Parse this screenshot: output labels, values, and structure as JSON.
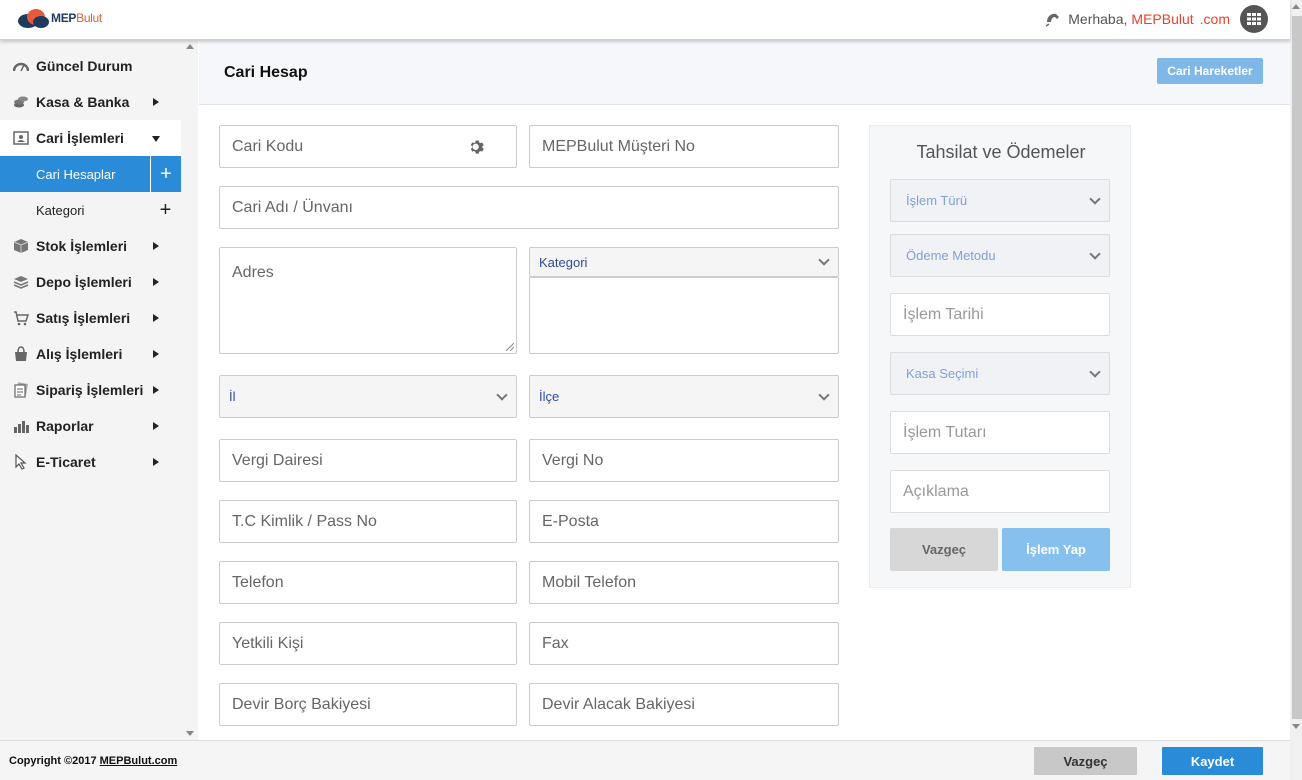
{
  "header": {
    "logo_main": "MEP",
    "logo_accent": "Bulut",
    "greeting": "Merhaba,",
    "brand": "MEPBulut",
    "domain": ".com"
  },
  "sidebar": {
    "items": [
      {
        "label": "Güncel Durum",
        "icon": "speedometer-icon"
      },
      {
        "label": "Kasa & Banka",
        "icon": "coins-icon"
      },
      {
        "label": "Cari İşlemleri",
        "icon": "contact-card-icon",
        "expanded": true
      },
      {
        "label": "Stok İşlemleri",
        "icon": "box-icon"
      },
      {
        "label": "Depo İşlemleri",
        "icon": "layers-icon"
      },
      {
        "label": "Satış İşlemleri",
        "icon": "cart-icon"
      },
      {
        "label": "Alış İşlemleri",
        "icon": "bag-icon"
      },
      {
        "label": "Sipariş İşlemleri",
        "icon": "documents-icon"
      },
      {
        "label": "Raporlar",
        "icon": "bar-chart-icon"
      },
      {
        "label": "E-Ticaret",
        "icon": "cursor-icon"
      }
    ],
    "subitems": [
      {
        "label": "Cari Hesaplar",
        "active": true
      },
      {
        "label": "Kategori",
        "active": false
      }
    ]
  },
  "page": {
    "title": "Cari Hesap",
    "action_button": "Cari Hareketler"
  },
  "form": {
    "cari_kodu": "Cari Kodu",
    "musteri_no": "MEPBulut Müşteri No",
    "cari_adi": "Cari Adı / Ünvanı",
    "adres": "Adres",
    "kategori": "Kategori",
    "il": "İl",
    "ilce": "İlçe",
    "vergi_dairesi": "Vergi Dairesi",
    "vergi_no": "Vergi No",
    "tc_kimlik": "T.C Kimlik / Pass No",
    "eposta": "E-Posta",
    "telefon": "Telefon",
    "mobil_telefon": "Mobil Telefon",
    "yetkili_kisi": "Yetkili Kişi",
    "fax": "Fax",
    "devir_borc": "Devir Borç Bakiyesi",
    "devir_alacak": "Devir Alacak Bakiyesi"
  },
  "payments": {
    "title": "Tahsilat ve Ödemeler",
    "islem_turu": "İşlem Türü",
    "odeme_metodu": "Ödeme Metodu",
    "islem_tarihi": "İşlem Tarihi",
    "kasa_secimi": "Kasa Seçimi",
    "islem_tutari": "İşlem Tutarı",
    "aciklama": "Açıklama",
    "cancel": "Vazgeç",
    "submit": "İşlem Yap"
  },
  "footer": {
    "copyright": "Copyright ©2017",
    "link": "MEPBulut.com",
    "cancel": "Vazgeç",
    "save": "Kaydet"
  },
  "colors": {
    "accent": "#2a8bd8",
    "brand_red": "#e8412b",
    "light_button": "#7fb8e8"
  }
}
